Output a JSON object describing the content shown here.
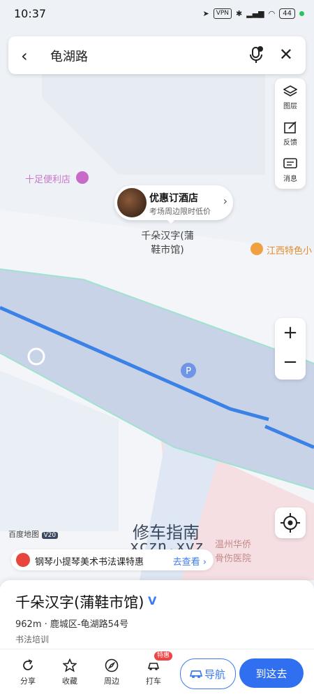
{
  "status_bar": {
    "time": "10:37",
    "vpn_label": "VPN",
    "battery": "44"
  },
  "search": {
    "query": "龟湖路"
  },
  "map_tools": [
    {
      "label": "图层",
      "icon": "layers-icon"
    },
    {
      "label": "反馈",
      "icon": "feedback-icon"
    },
    {
      "label": "消息",
      "icon": "message-icon"
    }
  ],
  "zoom": {
    "in_label": "+",
    "out_label": "−"
  },
  "promo_bubble": {
    "title": "优惠订酒店",
    "subtitle": "考场周边限时低价"
  },
  "selected_poi_label": {
    "line1": "千朵汉字(蒲",
    "line2": "鞋市馆)"
  },
  "map_labels": {
    "convenience_store": "十足便利店",
    "jiangxi": "江西特色小",
    "hospital_line1": "温州华侨",
    "hospital_line2": "骨伤医院",
    "parking": "P"
  },
  "brand": {
    "name": "百度地图",
    "version": "V20"
  },
  "ad_strip": {
    "text": "钢琴小提琴美术书法课特惠",
    "action": "去查看 ›"
  },
  "watermark": {
    "line1": "修车指南",
    "line2": "xczn.xyz"
  },
  "place": {
    "name": "千朵汉字(蒲鞋市馆)",
    "verified_mark": "V",
    "address": "962m · 鹿城区-龟湖路54号",
    "category": "书法培训"
  },
  "actions": [
    {
      "label": "分享",
      "icon": "share-icon"
    },
    {
      "label": "收藏",
      "icon": "star-icon"
    },
    {
      "label": "周边",
      "icon": "compass-icon"
    },
    {
      "label": "打车",
      "icon": "taxi-icon"
    }
  ],
  "taxi_badge": "特惠",
  "buttons": {
    "navigate": "导航",
    "go_here": "到这去"
  },
  "colors": {
    "accent": "#2f6ff0",
    "road": "#c8d2e6",
    "route": "#3b82e6"
  }
}
